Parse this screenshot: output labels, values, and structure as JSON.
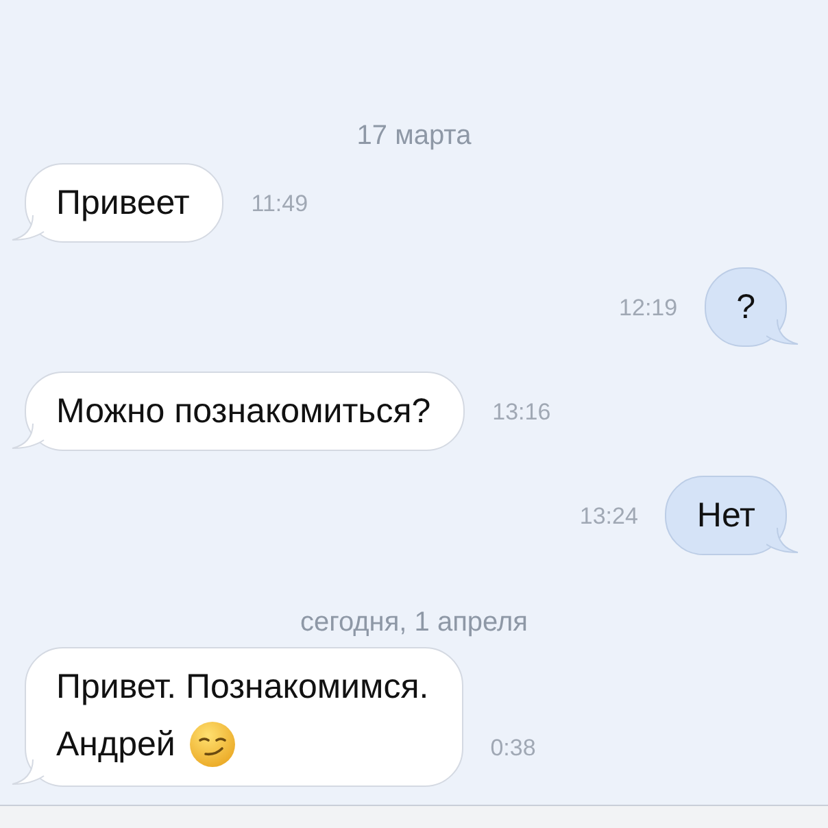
{
  "messages": [
    {
      "kind": "date",
      "text": "17 марта"
    },
    {
      "kind": "message",
      "outgoing": false,
      "lines": [
        "Привеет"
      ],
      "time": "11:49"
    },
    {
      "kind": "message",
      "outgoing": true,
      "lines": [
        "?"
      ],
      "time": "12:19"
    },
    {
      "kind": "message",
      "outgoing": false,
      "lines": [
        "Можно познакомиться?"
      ],
      "time": "13:16"
    },
    {
      "kind": "message",
      "outgoing": true,
      "lines": [
        "Нет"
      ],
      "time": "13:24"
    },
    {
      "kind": "date",
      "text": "сегодня, 1 апреля"
    },
    {
      "kind": "message",
      "outgoing": false,
      "lines": [
        "Привет. Познакомимся.",
        "Андрей"
      ],
      "smiley": true,
      "time": "0:38"
    }
  ]
}
